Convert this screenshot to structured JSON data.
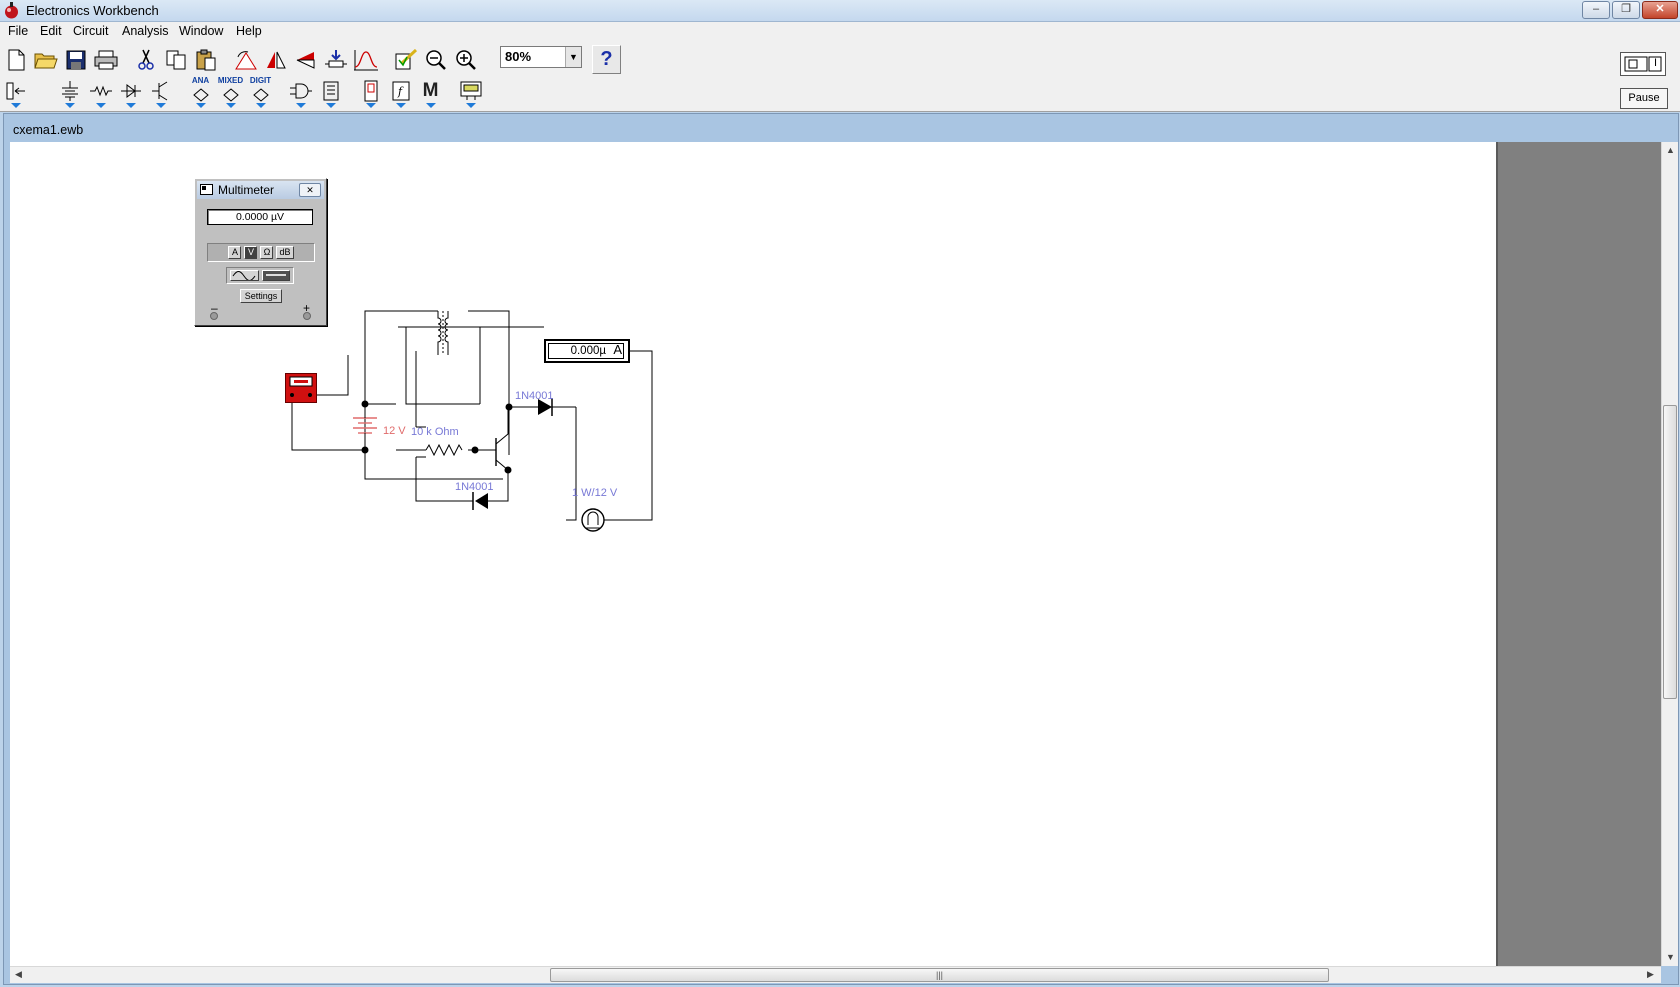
{
  "window": {
    "title": "Electronics Workbench",
    "minimize": "–",
    "restore": "❐",
    "close": "✕"
  },
  "menu": [
    "File",
    "Edit",
    "Circuit",
    "Analysis",
    "Window",
    "Help"
  ],
  "toolbar": {
    "zoom_value": "80%",
    "help_label": "?",
    "pause_label": "Pause",
    "power_label": "I",
    "parts_labels": {
      "analog": "ANA",
      "mixed": "MIXED",
      "digital": "DIGIT",
      "misc": "M"
    }
  },
  "document": {
    "title": "cxema1.ewb"
  },
  "multimeter": {
    "title": "Multimeter",
    "reading": "0.0000  µV",
    "modes": [
      "A",
      "V",
      "Ω",
      "dB"
    ],
    "active_mode": "V",
    "settings_label": "Settings",
    "minus_label": "–",
    "plus_label": "+"
  },
  "circuit": {
    "ammeter_reading": "0.000µ",
    "ammeter_unit": "A",
    "diode_top_label": "1N4001",
    "diode_bottom_label": "1N4001",
    "resistor_label": "10 k Ohm",
    "battery_label": "12 V",
    "lamp_label": "1 W/12 V"
  },
  "colors": {
    "component_label": "#7879d6",
    "battery_label": "#e06b6b",
    "probe_red": "#d01010",
    "workspace_bg": "#ffffff",
    "gray_area": "#808080"
  }
}
